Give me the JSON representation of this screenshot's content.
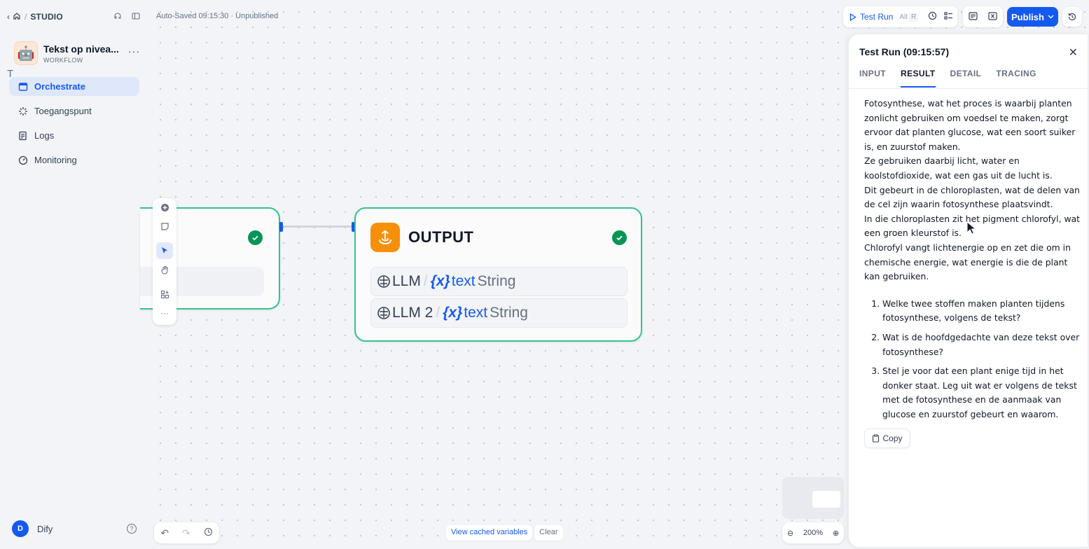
{
  "nav": {
    "studio": "STUDIO"
  },
  "app": {
    "name": "Tekst op nivea...",
    "type": "WORKFLOW",
    "icon": "robot-emoji",
    "avatar_bg": "#fde8d7"
  },
  "sidebar": {
    "items": [
      {
        "label": "Orchestrate",
        "icon": "orchestrate-icon",
        "active": true
      },
      {
        "label": "Toegangspunt",
        "icon": "access-point-icon",
        "active": false
      },
      {
        "label": "Logs",
        "icon": "logs-icon",
        "active": false
      },
      {
        "label": "Monitoring",
        "icon": "monitoring-icon",
        "active": false
      }
    ]
  },
  "user": {
    "initial": "D",
    "name": "Dify"
  },
  "canvas": {
    "autosave": "Auto-Saved 09:15:30 · Unpublished",
    "left_node_fragment": "T",
    "output_node": {
      "title": "OUTPUT",
      "vars": [
        {
          "source": "LLM",
          "name": "text",
          "type": "String"
        },
        {
          "source": "LLM 2",
          "name": "text",
          "type": "String"
        }
      ]
    },
    "cached": {
      "view": "View cached variables",
      "clear": "Clear"
    },
    "zoom": "200%"
  },
  "toolbar": {
    "test_run": "Test Run",
    "shortcut_alt": "Alt",
    "shortcut_key": "R",
    "publish": "Publish"
  },
  "panel": {
    "title": "Test Run (09:15:57)",
    "tabs": [
      "INPUT",
      "RESULT",
      "DETAIL",
      "TRACING"
    ],
    "active_tab": "RESULT",
    "paragraphs": [
      "Fotosynthese, wat het proces is waarbij planten zonlicht gebruiken om voedsel te maken, zorgt ervoor dat planten glucose, wat een soort suiker is, en zuurstof maken.",
      "Ze gebruiken daarbij licht, water en koolstofdioxide, wat een gas uit de lucht is.",
      "Dit gebeurt in de chloroplasten, wat de delen van de cel zijn waarin fotosynthese plaatsvindt.",
      "In die chloroplasten zit het pigment chlorofyl, wat een groen kleurstof is.",
      "Chlorofyl vangt lichtenergie op en zet die om in chemische energie, wat energie is die de plant kan gebruiken."
    ],
    "questions": [
      "Welke twee stoffen maken planten tijdens fotosynthese, volgens de tekst?",
      "Wat is de hoofdgedachte van deze tekst over fotosynthese?",
      "Stel je voor dat een plant enige tijd in het donker staat. Leg uit wat er volgens de tekst met de fotosynthese en de aanmaak van glucose en zuurstof gebeurt en waarom."
    ],
    "copy": "Copy"
  },
  "colors": {
    "accent": "#155aef",
    "success": "#079455",
    "node_border": "#34c38f",
    "output_icon": "#f79009"
  }
}
